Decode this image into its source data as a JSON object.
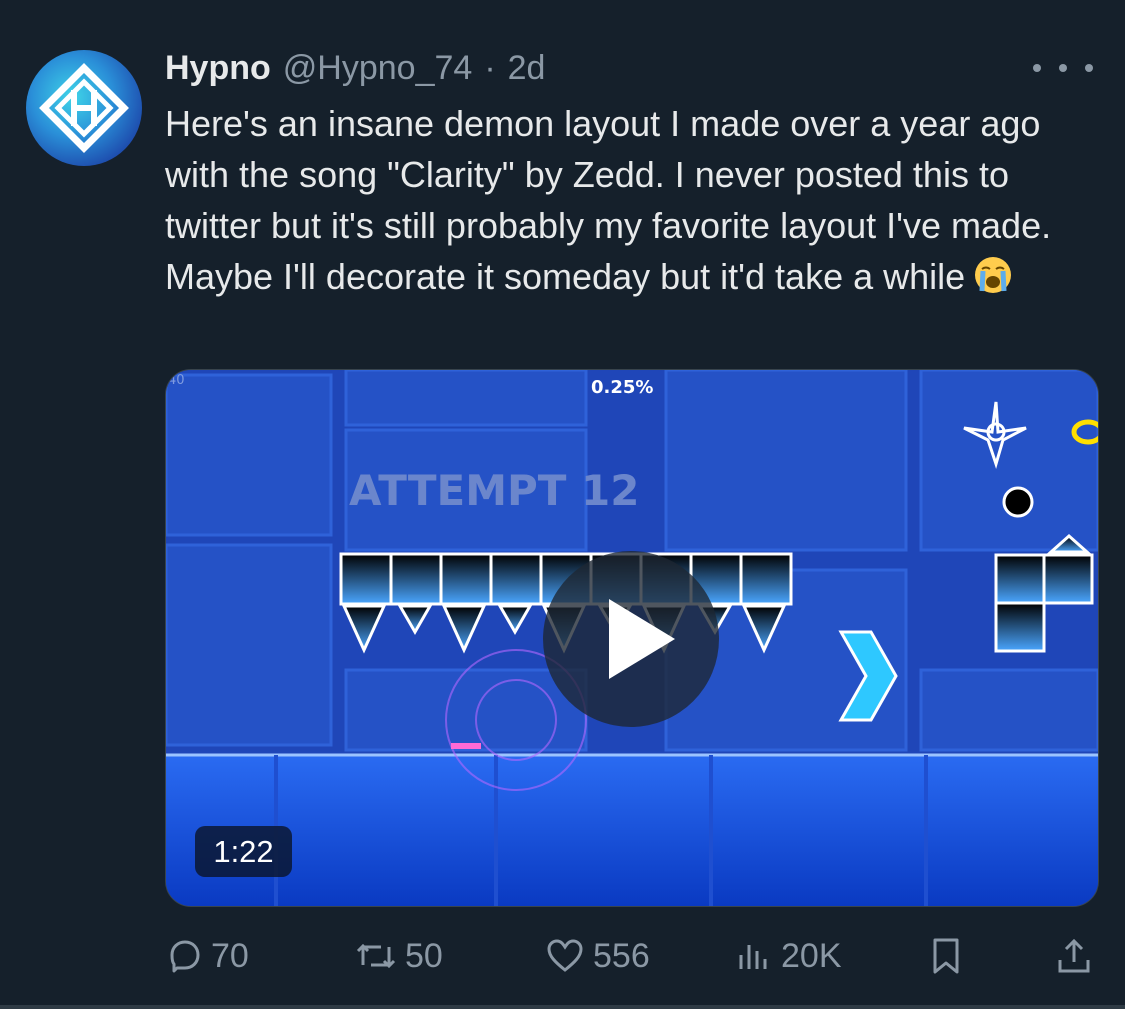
{
  "tweet": {
    "author_name": "Hypno",
    "author_handle": "@Hypno_74",
    "separator": "·",
    "time": "2d",
    "text": "Here's an insane demon layout I made over a year ago with the song \"Clarity\" by Zedd. I never posted this to twitter but it's still probably my favorite layout I've made. Maybe I'll decorate it someday but it'd take a while",
    "emoji": "loudly-crying-face-emoji"
  },
  "media": {
    "type": "video",
    "duration": "1:22",
    "overlay_progress": "0.25%",
    "overlay_attempt": "ATTEMPT 12",
    "overlay_corner": "40"
  },
  "actions": {
    "replies": "70",
    "retweets": "50",
    "likes": "556",
    "views": "20K"
  },
  "colors": {
    "background": "#15202b",
    "text": "#e7e9ea",
    "muted": "#8b98a5",
    "game_blue": "#1d3fa8"
  }
}
